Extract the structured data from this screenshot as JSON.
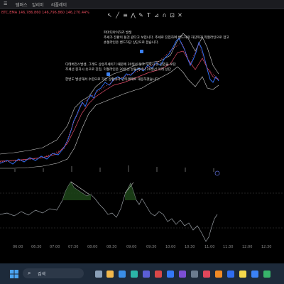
{
  "topbar": {
    "tabs": [
      "템퍼스",
      "알리미",
      "리플레이"
    ]
  },
  "ticker": {
    "text": "BTC,EMA  146,786.860  146,796.860  146,270.44%"
  },
  "annotations": {
    "a1": "파마디아이하즈 발생",
    "a2": "추세가 전환이 될것 같다고 보입니다. 추세로 진입하여 밴드하락 하단까지 익절라인으로 잡고",
    "a3": "손절라인은 밴드하단 상단으로 잡습니다.",
    "a4": "디테버전스발생, 그레도 상승추세이기 때문에 20일선 닿고 하락시 숏 진입을 보던",
    "a5": "추세선 붕괴시 숏으로 진입, 익절라인은 20일선 날물에서나 20일선 아래 상단",
    "a6": "한번도 발산해서 수렴으로 가는 상황이다 단타매매로 대응하겠습니다."
  },
  "time_axis": [
    "06:00",
    "06:30",
    "07:00",
    "07:30",
    "08:00",
    "08:30",
    "09:00",
    "09:30",
    "10:00",
    "10:30",
    "11:00",
    "11:30",
    "12:00",
    "12:30"
  ],
  "taskbar": {
    "search_placeholder": "검색"
  },
  "colors": {
    "bull": "#2f6df0",
    "bear": "#e24d6a",
    "band": "#cfcfcf",
    "osc": "#7fbf6a",
    "bg": "#000000"
  }
}
